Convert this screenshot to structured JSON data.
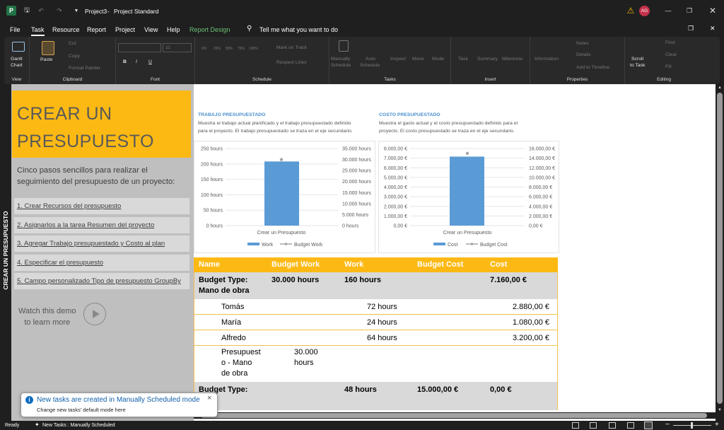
{
  "titlebar": {
    "file_name": "Project3",
    "separator": "-",
    "app_name": "Project Standard",
    "avatar": "AG"
  },
  "menu": [
    "File",
    "Task",
    "Resource",
    "Report",
    "Project",
    "View",
    "Help",
    "Report Design"
  ],
  "tell_me": "Tell me what you want to do",
  "ribbon": {
    "view": {
      "gantt": "Gantt",
      "chart": "Chart",
      "label": "View"
    },
    "clipboard": {
      "paste": "Paste",
      "cut": "Cut",
      "copy": "Copy",
      "format_painter": "Format Painter",
      "label": "Clipboard"
    },
    "font": {
      "size": "11",
      "bold": "B",
      "italic": "I",
      "underline": "U",
      "label": "Font"
    },
    "schedule": {
      "pcts": [
        "0%",
        "25%",
        "50%",
        "75%",
        "100%"
      ],
      "mark_on_track": "Mark on Track",
      "respect_links": "Respect Links",
      "label": "Schedule"
    },
    "tasks": {
      "manually": "Manually",
      "schedule": "Schedule",
      "auto": "Auto",
      "auto_schedule": "Schedule",
      "inspect": "Inspect",
      "move": "Move",
      "mode": "Mode",
      "label": "Tasks"
    },
    "insert": {
      "task": "Task",
      "summary": "Summary",
      "milestone": "Milestone",
      "label": "Insert"
    },
    "properties": {
      "information": "Information",
      "notes": "Notes",
      "details": "Details",
      "add_timeline": "Add to Timeline",
      "label": "Properties"
    },
    "editing": {
      "scroll1": "Scroll",
      "scroll2": "to Task",
      "find": "Find",
      "clear": "Clear",
      "fill": "Fill",
      "label": "Editing"
    }
  },
  "side_tab": "CREAR UN PRESUPUESTO",
  "panel": {
    "hero": [
      "CREAR UN",
      "PRESUPUESTO"
    ],
    "intro": "Cinco pasos sencillos para realizar el seguimiento del presupuesto de un proyecto:",
    "steps": [
      "1. Crear Recursos del presupuesto",
      "2. Asignarlos a la tarea Resumen del proyecto",
      "3. Agregar Trabajo presupuestado y Costo al plan",
      "4. Especificar el presupuesto",
      "5. Campo personalizado Tipo de presupuesto GroupBy"
    ],
    "demo": [
      "Watch this demo",
      "to learn more"
    ]
  },
  "report": {
    "work": {
      "title": "TRABAJO PRESUPUESTADO",
      "desc": [
        "Muestra el trabajo actual planificado y el trabajo presupuestado definido",
        "para el proyecto. El trabajo presupuestado se traza en el eje secundario."
      ]
    },
    "cost": {
      "title": "COSTO PRESUPUESTADO",
      "desc": [
        "Muestra el gasto actual y el costo presupuestado definido para el",
        "proyecto. El costo presupuestado se traza en el eje secundario."
      ]
    }
  },
  "chart_data": [
    {
      "type": "bar",
      "categories": [
        "Crear un Presupuesto"
      ],
      "series": [
        {
          "name": "Work",
          "values": [
            208
          ]
        },
        {
          "name": "Budget Work",
          "values": [
            30000
          ],
          "axis": "secondary",
          "marker": "point"
        }
      ],
      "y_ticks": [
        "0 hours",
        "50 hours",
        "100 hours",
        "150 hours",
        "200 hours",
        "250 hours"
      ],
      "ylim": [
        0,
        250
      ],
      "y2_ticks": [
        "0 hours",
        "5.000 hours",
        "10.000 hours",
        "15.000 hours",
        "20.000 hours",
        "25.000 hours",
        "30.000 hours",
        "35.000 hours"
      ],
      "y2lim": [
        0,
        35000
      ],
      "legend_position": "bottom",
      "colors": {
        "bar": "#5b9bd5",
        "marker": "#a5a5a5"
      }
    },
    {
      "type": "bar",
      "categories": [
        "Crear un Presupuesto"
      ],
      "series": [
        {
          "name": "Cost",
          "values": [
            7160
          ]
        },
        {
          "name": "Budget Cost",
          "values": [
            15000
          ],
          "axis": "secondary",
          "marker": "point"
        }
      ],
      "y_ticks": [
        "0,00 €",
        "1.000,00 €",
        "2.000,00 €",
        "3.000,00 €",
        "4.000,00 €",
        "5.000,00 €",
        "6.000,00 €",
        "7.000,00 €",
        "8.000,00 €"
      ],
      "ylim": [
        0,
        8000
      ],
      "y2_ticks": [
        "0,00 €",
        "2.000,00 €",
        "4.000,00 €",
        "6.000,00 €",
        "8.000,00 €",
        "10.000,00 €",
        "12.000,00 €",
        "14.000,00 €",
        "16.000,00 €"
      ],
      "y2lim": [
        0,
        16000
      ],
      "legend_position": "bottom",
      "colors": {
        "bar": "#5b9bd5",
        "marker": "#a5a5a5"
      }
    }
  ],
  "table": {
    "headers": [
      "Name",
      "Budget Work",
      "Work",
      "Budget Cost",
      "Cost"
    ],
    "group1": {
      "line1": "Budget Type:",
      "line2": "Mano de obra",
      "budget_work": "30.000 hours",
      "work": "160 hours",
      "cost": "7.160,00 €"
    },
    "rows": [
      {
        "name": "Tomás",
        "work": "72 hours",
        "cost": "2.880,00 €"
      },
      {
        "name": "María",
        "work": "24 hours",
        "cost": "1.080,00 €"
      },
      {
        "name": "Alfredo",
        "work": "64 hours",
        "cost": "3.200,00 €"
      }
    ],
    "row4": {
      "name": [
        "Presupuest",
        "o - Mano",
        "de obra"
      ],
      "budget_work": [
        "30.000",
        "hours"
      ]
    },
    "group2": {
      "line1": "Budget Type:",
      "work": "48 hours",
      "budget_cost": "15.000,00 €",
      "cost": "0,00 €"
    }
  },
  "toast": {
    "title": "New tasks are created in Manually Scheduled mode",
    "subtitle": "Change new tasks' default mode here",
    "close": "×"
  },
  "status": {
    "ready": "Ready",
    "new_tasks": "New Tasks : Manually Scheduled"
  }
}
